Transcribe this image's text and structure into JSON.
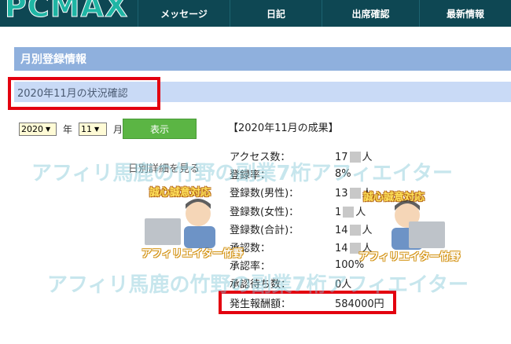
{
  "header": {
    "logo_text": "PCMAX",
    "nav": [
      {
        "label": "メッセージ"
      },
      {
        "label": "日記"
      },
      {
        "label": "出席確認"
      },
      {
        "label": "最新情報"
      }
    ]
  },
  "section": {
    "title": "月別登録情報",
    "subtitle": "2020年11月の状況確認"
  },
  "controls": {
    "year_value": "2020",
    "year_label": "年",
    "month_value": "11",
    "month_label": "月",
    "show_button": "表示",
    "daily_link": "日別詳細を見る"
  },
  "results": {
    "title": "【2020年11月の成果】",
    "rows": [
      {
        "label": "アクセス数：",
        "prefix": "17",
        "suffix": "人"
      },
      {
        "label": "登録率：",
        "prefix": "8%",
        "suffix": ""
      },
      {
        "label": "登録数(男性)：",
        "prefix": "13",
        "suffix": "人"
      },
      {
        "label": "登録数(女性)：",
        "prefix": "1",
        "suffix": "人"
      },
      {
        "label": "登録数(合計)：",
        "prefix": "14",
        "suffix": "人"
      },
      {
        "label": "承認数：",
        "prefix": "14",
        "suffix": "人"
      },
      {
        "label": "承認率：",
        "prefix": "100%",
        "suffix": ""
      },
      {
        "label": "承認待ち数：",
        "prefix": "0人",
        "suffix": ""
      },
      {
        "label": "発生報酬額：",
        "prefix": "584000円",
        "suffix": ""
      }
    ]
  },
  "watermarks": {
    "line1": "アフィリ馬鹿の竹野の副業7桁アフィエイター",
    "line2": "アフィリ馬鹿の竹野の副業7桁アフィエイター",
    "tag_honest_1": "誠心誠意対応",
    "tag_honest_2": "誠心誠意対応",
    "tag_affiliate_1": "アフィリエイター竹野",
    "tag_affiliate_2": "アフィリエイター竹野"
  },
  "colors": {
    "header_bg": "#0e4753",
    "logo": "#1fb5a4",
    "section_title_bg": "#8fb0dd",
    "subtitle_bg": "#c9daf6",
    "highlight_red": "#e3000f",
    "button_green": "#5bb544"
  }
}
